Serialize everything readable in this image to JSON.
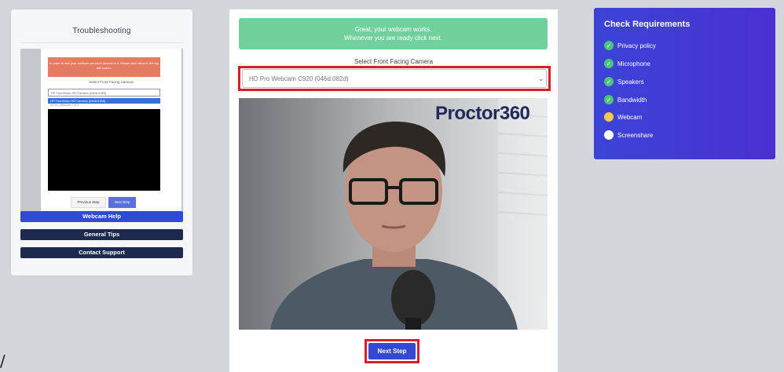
{
  "troubleshooting": {
    "title": "Troubleshooting",
    "thumbnail": {
      "alert_text": "In order to test your webcam we need access to it. Please click allow in the top left corner.",
      "label": "Select Front Facing Camera",
      "select_value": "HP TrueVision HD Camera (0408:5365)",
      "option_selected": "HP TrueVision HD Camera (0408:5365)",
      "option_other": "HD Pro Webcam C920",
      "prev_label": "Previous Step",
      "next_label": "Next Step"
    },
    "buttons": {
      "webcam_help": "Webcam Help",
      "general_tips": "General Tips",
      "contact_support": "Contact Support"
    }
  },
  "main": {
    "banner_line1": "Great, your webcam works.",
    "banner_line2": "Whenever you are ready click next.",
    "select_label": "Select Front Facing Camera",
    "select_value": "HD Pro Webcam C920 (046d:082d)",
    "watermark": "Proctor360",
    "next_button": "Next Step"
  },
  "requirements": {
    "title": "Check Requirements",
    "items": [
      {
        "label": "Privacy policy",
        "status": "done"
      },
      {
        "label": "Microphone",
        "status": "done"
      },
      {
        "label": "Speakers",
        "status": "done"
      },
      {
        "label": "Bandwidth",
        "status": "done"
      },
      {
        "label": "Webcam",
        "status": "pending"
      },
      {
        "label": "Screenshare",
        "status": "todo"
      }
    ]
  },
  "misc": {
    "slash": "/"
  },
  "colors": {
    "accent_blue": "#3448d6",
    "success_green": "#72d09f",
    "highlight_red": "#d42027",
    "navy": "#1d2a4e"
  }
}
